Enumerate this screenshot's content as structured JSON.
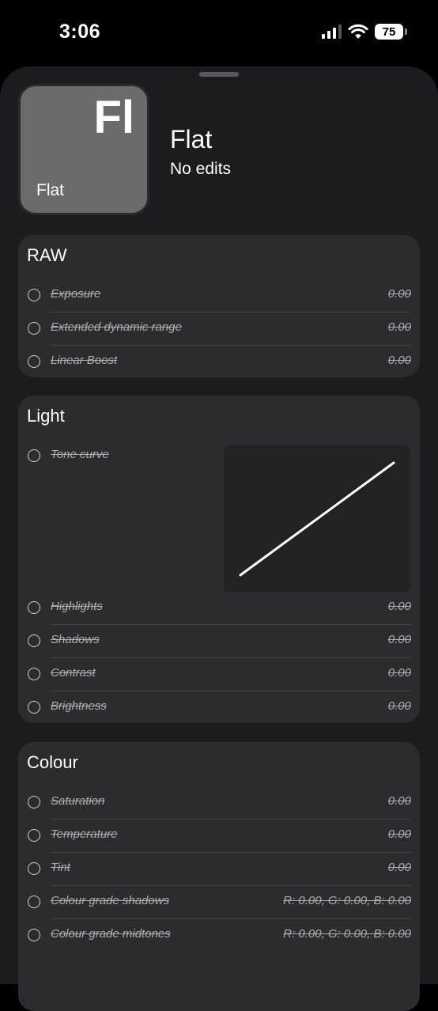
{
  "status_bar": {
    "time": "3:06",
    "battery_level": "75",
    "icons": [
      "signal-icon",
      "wifi-icon",
      "battery-icon"
    ]
  },
  "header": {
    "tile_symbol": "Fl",
    "tile_name": "Flat",
    "title": "Flat",
    "subtitle": "No edits"
  },
  "sections": {
    "raw": {
      "title": "RAW",
      "rows": [
        {
          "label": "Exposure",
          "value": "0.00"
        },
        {
          "label": "Extended dynamic range",
          "value": "0.00"
        },
        {
          "label": "Linear Boost",
          "value": "0.00"
        }
      ]
    },
    "light": {
      "title": "Light",
      "tone_curve": {
        "label": "Tone curve"
      },
      "rows": [
        {
          "label": "Highlights",
          "value": "0.00"
        },
        {
          "label": "Shadows",
          "value": "0.00"
        },
        {
          "label": "Contrast",
          "value": "0.00"
        },
        {
          "label": "Brightness",
          "value": "0.00"
        }
      ]
    },
    "colour": {
      "title": "Colour",
      "rows": [
        {
          "label": "Saturation",
          "value": "0.00"
        },
        {
          "label": "Temperature",
          "value": "0.00"
        },
        {
          "label": "Tint",
          "value": "0.00"
        },
        {
          "label": "Colour grade shadows",
          "value": "R: 0.00, G: 0.00, B: 0.00"
        },
        {
          "label": "Colour grade midtones",
          "value": "R: 0.00, G: 0.00, B: 0.00"
        }
      ]
    }
  },
  "colors": {
    "background": "#000000",
    "sheet": "#1c1c1e",
    "card": "#2c2c2e",
    "tile": "#6b6b6b",
    "muted_text": "#aeaeb2"
  }
}
